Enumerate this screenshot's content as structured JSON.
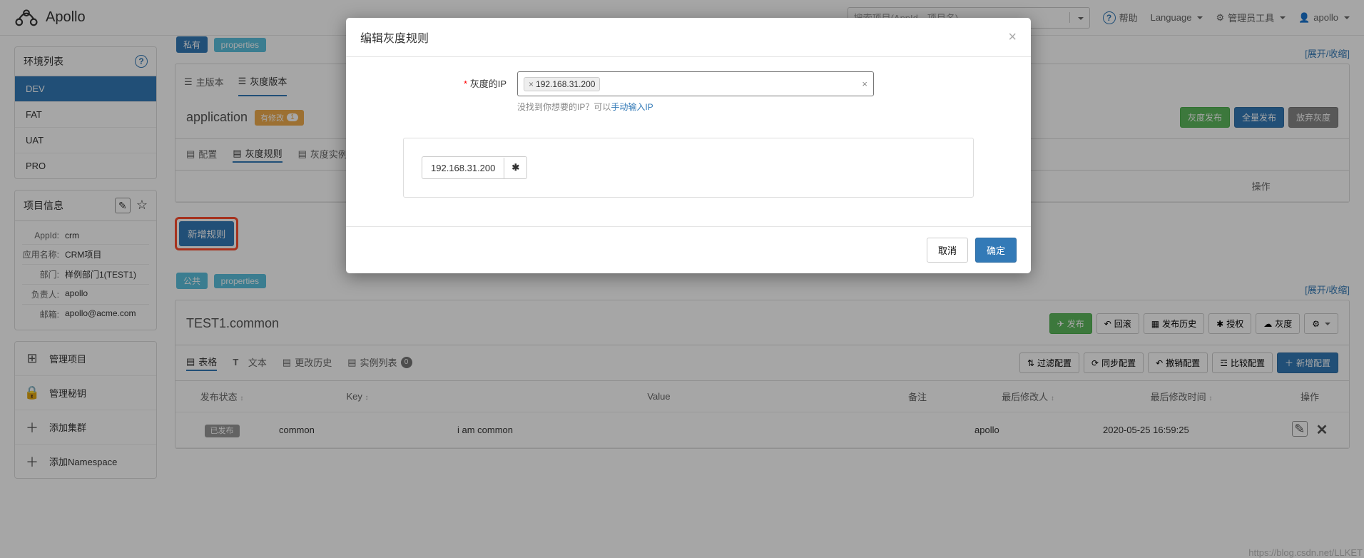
{
  "brand": "Apollo",
  "search_placeholder": "搜索项目(AppId、项目名)",
  "nav": {
    "help": "帮助",
    "language": "Language",
    "admin": "管理员工具",
    "user": "apollo"
  },
  "env_panel": {
    "title": "环境列表",
    "items": [
      "DEV",
      "FAT",
      "UAT",
      "PRO"
    ],
    "active": "DEV"
  },
  "proj_panel": {
    "title": "项目信息",
    "rows": [
      {
        "label": "AppId:",
        "value": "crm"
      },
      {
        "label": "应用名称:",
        "value": "CRM项目"
      },
      {
        "label": "部门:",
        "value": "样例部门1(TEST1)"
      },
      {
        "label": "负责人:",
        "value": "apollo"
      },
      {
        "label": "邮箱:",
        "value": "apollo@acme.com"
      }
    ]
  },
  "actions": [
    {
      "icon": "grid",
      "label": "管理项目"
    },
    {
      "icon": "lock",
      "label": "管理秘钥"
    },
    {
      "icon": "plus",
      "label": "添加集群"
    },
    {
      "icon": "plus",
      "label": "添加Namespace"
    }
  ],
  "toggle": "[展开/收缩]",
  "ns1": {
    "visibility": "私有",
    "format": "properties",
    "tabs": {
      "main": "主版本",
      "gray": "灰度版本"
    },
    "title": "application",
    "mod_badge": "有修改",
    "mod_count": "1",
    "buttons": {
      "pub_gray": "灰度发布",
      "pub_full": "全量发布",
      "discard": "放弃灰度"
    },
    "sub_tabs": {
      "config": "配置",
      "rule": "灰度规则",
      "instance": "灰度实例列表"
    },
    "table_headers": [
      "操作"
    ],
    "add_rule": "新增规则"
  },
  "ns2": {
    "visibility": "公共",
    "format": "properties",
    "title": "TEST1.common",
    "buttons": {
      "publish": "发布",
      "rollback": "回滚",
      "history": "发布历史",
      "auth": "授权",
      "gray": "灰度"
    },
    "sub_tabs": {
      "table": "表格",
      "text": "文本",
      "hist": "更改历史",
      "inst": "实例列表",
      "inst_count": "0"
    },
    "tool_buttons": {
      "filter": "过滤配置",
      "sync": "同步配置",
      "revoke": "撤销配置",
      "compare": "比较配置",
      "add": "新增配置"
    },
    "headers": {
      "status": "发布状态",
      "key": "Key",
      "value": "Value",
      "remark": "备注",
      "modifier": "最后修改人",
      "mtime": "最后修改时间",
      "op": "操作"
    },
    "row": {
      "status": "已发布",
      "key": "common",
      "value": "i am common",
      "remark": "",
      "modifier": "apollo",
      "mtime": "2020-05-25 16:59:25"
    }
  },
  "modal": {
    "title": "编辑灰度规则",
    "label": "灰度的IP",
    "chip": "192.168.31.200",
    "hint_pre": "没找到你想要的IP？可以",
    "hint_link": "手动输入IP",
    "ip_value": "192.168.31.200",
    "cancel": "取消",
    "confirm": "确定"
  },
  "watermark": "https://blog.csdn.net/LLKET"
}
